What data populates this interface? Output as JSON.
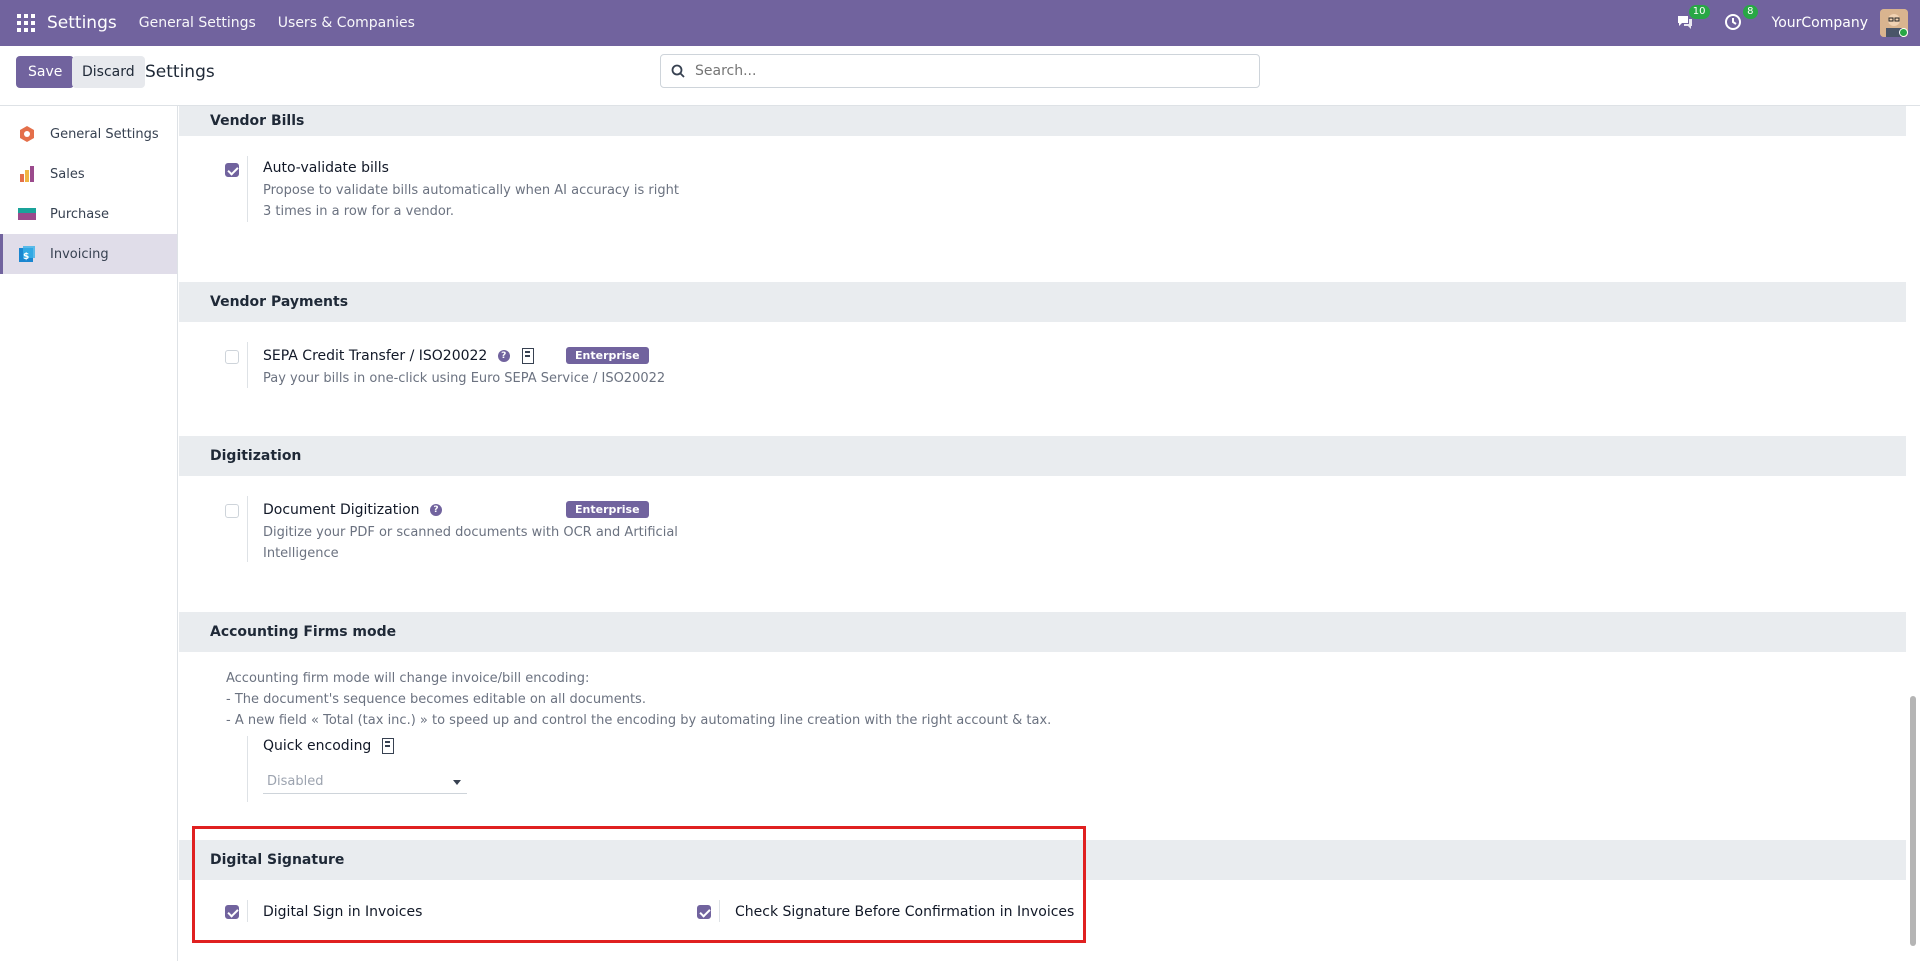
{
  "navbar": {
    "app_title": "Settings",
    "links": [
      "General Settings",
      "Users & Companies"
    ],
    "messages_count": "10",
    "activities_count": "8",
    "company": "YourCompany"
  },
  "control": {
    "save_label": "Save",
    "discard_label": "Discard",
    "title": "Settings",
    "search_placeholder": "Search..."
  },
  "sidebar": {
    "items": [
      {
        "label": "General Settings",
        "icon": "odoo-logo-icon",
        "active": false
      },
      {
        "label": "Sales",
        "icon": "sales-chart-icon",
        "active": false
      },
      {
        "label": "Purchase",
        "icon": "purchase-card-icon",
        "active": false
      },
      {
        "label": "Invoicing",
        "icon": "invoice-dollar-icon",
        "active": true
      }
    ]
  },
  "sections": {
    "vendor_bills": {
      "heading": "Vendor Bills",
      "auto_validate_title": "Auto-validate bills",
      "auto_validate_desc_1": "Propose to validate bills automatically when AI accuracy is right",
      "auto_validate_desc_2": "3 times in a row for a vendor.",
      "auto_validate_checked": true
    },
    "vendor_payments": {
      "heading": "Vendor Payments",
      "sepa_title": "SEPA Credit Transfer / ISO20022",
      "sepa_desc": "Pay your bills in one-click using Euro SEPA Service / ISO20022",
      "sepa_badge": "Enterprise",
      "sepa_checked": false
    },
    "digitization": {
      "heading": "Digitization",
      "doc_title": "Document Digitization",
      "doc_desc_1": "Digitize your PDF or scanned documents with OCR and Artificial",
      "doc_desc_2": "Intelligence",
      "doc_badge": "Enterprise",
      "doc_checked": false
    },
    "accounting_firms": {
      "heading": "Accounting Firms mode",
      "desc_1": "Accounting firm mode will change invoice/bill encoding:",
      "desc_2": "- The document's sequence becomes editable on all documents.",
      "desc_3": "- A new field « Total (tax inc.) » to speed up and control the encoding by automating line creation with the right account & tax.",
      "quick_encoding_label": "Quick encoding",
      "quick_encoding_value": "Disabled"
    },
    "digital_signature": {
      "heading": "Digital Signature",
      "sign_invoices_label": "Digital Sign in Invoices",
      "sign_invoices_checked": true,
      "check_signature_label": "Check Signature Before Confirmation in Invoices",
      "check_signature_checked": true
    }
  },
  "colors": {
    "brand": "#71639e",
    "highlight": "#e02020",
    "badge_green": "#28a745"
  }
}
